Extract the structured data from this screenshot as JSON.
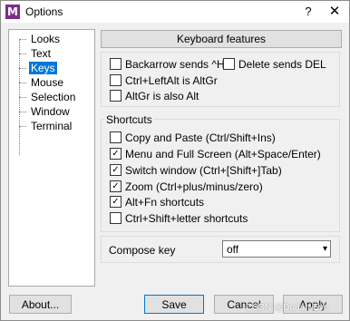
{
  "window": {
    "title": "Options",
    "app_icon_letter": "M"
  },
  "tree": {
    "items": [
      {
        "label": "Looks"
      },
      {
        "label": "Text"
      },
      {
        "label": "Keys"
      },
      {
        "label": "Mouse"
      },
      {
        "label": "Selection"
      },
      {
        "label": "Window"
      },
      {
        "label": "Terminal"
      }
    ],
    "selected": "Keys"
  },
  "header": {
    "label": "Keyboard features"
  },
  "features": {
    "backarrow": {
      "label": "Backarrow sends ^H",
      "checked": false
    },
    "delete": {
      "label": "Delete sends DEL",
      "checked": false
    },
    "ctrl_leftalt": {
      "label": "Ctrl+LeftAlt is AltGr",
      "checked": false
    },
    "altgr_alt": {
      "label": "AltGr is also Alt",
      "checked": false
    }
  },
  "shortcuts": {
    "group_label": "Shortcuts",
    "copy_paste": {
      "label": "Copy and Paste (Ctrl/Shift+Ins)",
      "checked": false
    },
    "menu_fullscreen": {
      "label": "Menu and Full Screen (Alt+Space/Enter)",
      "checked": true
    },
    "switch_window": {
      "label": "Switch window (Ctrl+[Shift+]Tab)",
      "checked": true
    },
    "zoom": {
      "label": "Zoom (Ctrl+plus/minus/zero)",
      "checked": true
    },
    "alt_fn": {
      "label": "Alt+Fn shortcuts",
      "checked": true
    },
    "ctrl_shift_letter": {
      "label": "Ctrl+Shift+letter shortcuts",
      "checked": false
    }
  },
  "compose": {
    "label": "Compose key",
    "value": "off"
  },
  "buttons": {
    "about": "About...",
    "save": "Save",
    "cancel": "Cancel",
    "apply": "Apply"
  },
  "watermark": "CSDN @Durian-Evc",
  "colors": {
    "accent": "#0078d7",
    "app_icon": "#7b2d8e"
  }
}
